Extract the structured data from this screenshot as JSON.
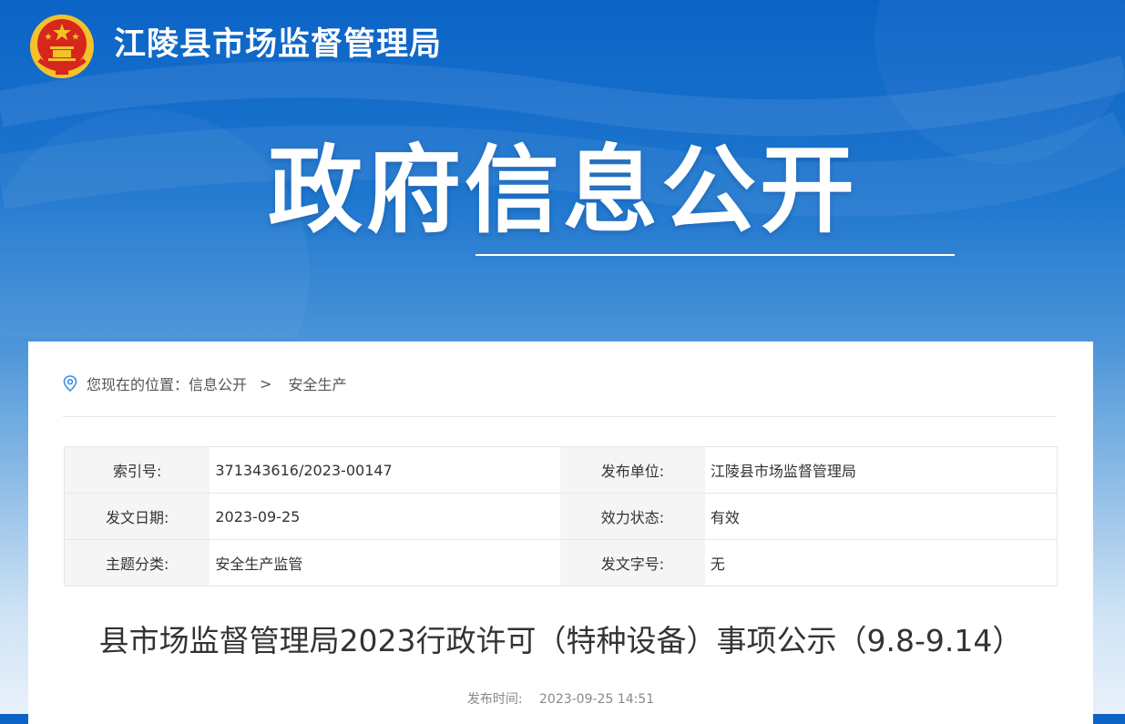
{
  "header": {
    "site_title": "江陵县市场监督管理局",
    "hero_title": "政府信息公开",
    "colors": {
      "banner_top": "#0b63c6",
      "banner_bottom": "#e8f1fa",
      "emblem_red": "#d7261e",
      "emblem_gold": "#f3c22a"
    }
  },
  "breadcrumb": {
    "prefix": "您现在的位置：",
    "items": [
      "信息公开",
      "安全生产"
    ],
    "separator": ">",
    "icon": "location-pin-icon"
  },
  "meta_table": {
    "rows": [
      {
        "label1": "索引号:",
        "value1": "371343616/2023-00147",
        "label2": "发布单位:",
        "value2": "江陵县市场监督管理局"
      },
      {
        "label1": "发文日期:",
        "value1": "2023-09-25",
        "label2": "效力状态:",
        "value2": "有效"
      },
      {
        "label1": "主题分类:",
        "value1": "安全生产监管",
        "label2": "发文字号:",
        "value2": "无"
      }
    ]
  },
  "article": {
    "title": "县市场监督管理局2023行政许可（特种设备）事项公示（9.8-9.14）",
    "publish_label": "发布时间:",
    "publish_time": "2023-09-25 14:51"
  }
}
